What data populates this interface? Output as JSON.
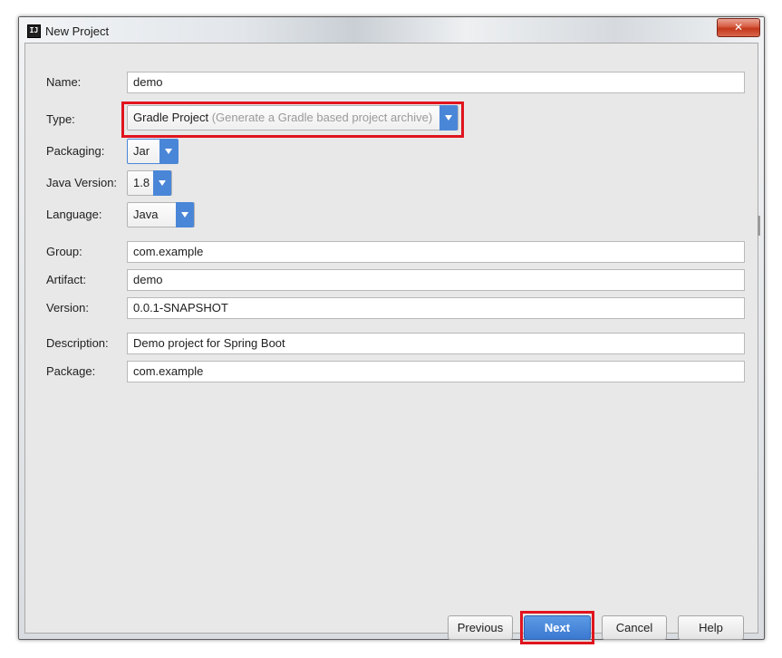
{
  "window": {
    "title": "New Project",
    "app_icon": "IJ",
    "close_glyph": "✕"
  },
  "form": {
    "name": {
      "label": "Name:",
      "value": "demo"
    },
    "type": {
      "label": "Type:",
      "value": "Gradle Project",
      "hint": "(Generate a Gradle based project archive)"
    },
    "packaging": {
      "label": "Packaging:",
      "value": "Jar"
    },
    "java_version": {
      "label": "Java Version:",
      "value": "1.8"
    },
    "language": {
      "label": "Language:",
      "value": "Java"
    },
    "group": {
      "label": "Group:",
      "value": "com.example"
    },
    "artifact": {
      "label": "Artifact:",
      "value": "demo"
    },
    "version": {
      "label": "Version:",
      "value": "0.0.1-SNAPSHOT"
    },
    "description": {
      "label": "Description:",
      "value": "Demo project for Spring Boot"
    },
    "package": {
      "label": "Package:",
      "value": "com.example"
    }
  },
  "buttons": {
    "previous": "Previous",
    "next": "Next",
    "cancel": "Cancel",
    "help": "Help"
  },
  "colors": {
    "accent": "#4a86d8",
    "highlight": "#e0141e"
  },
  "icons": {
    "dropdown": "chevron-down-icon",
    "close": "close-icon",
    "app": "intellij-icon"
  }
}
